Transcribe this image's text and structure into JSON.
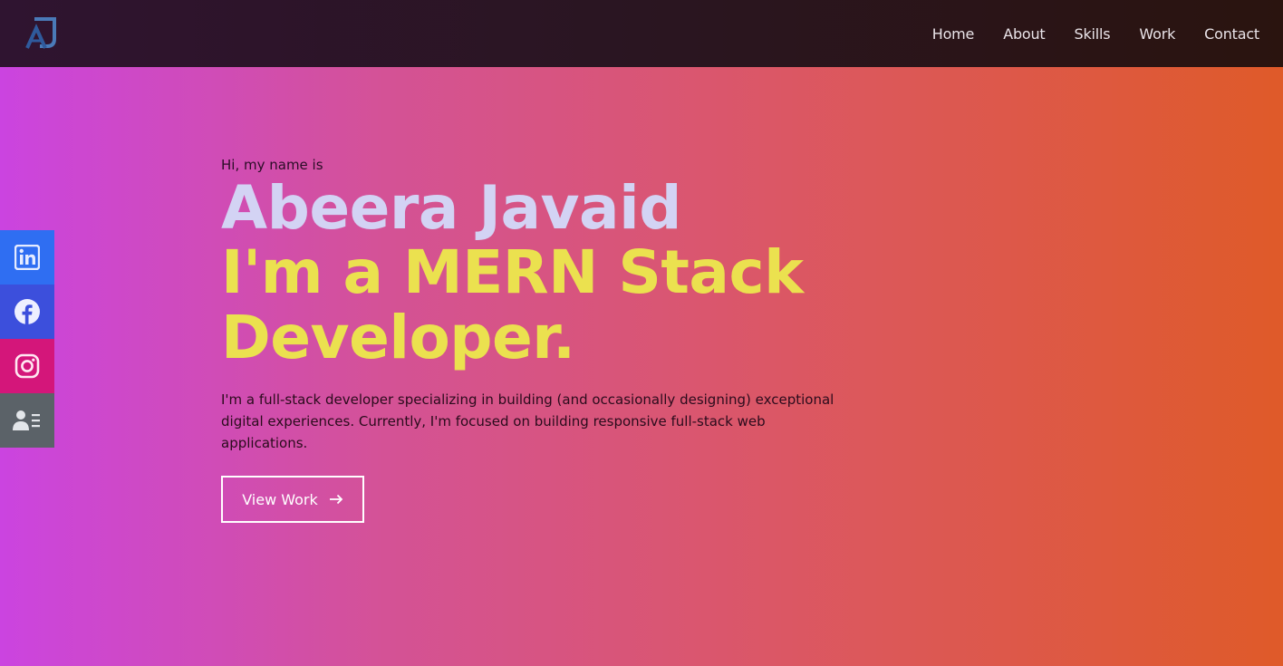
{
  "nav": {
    "logo_icon": "aj-monogram-logo",
    "links": [
      {
        "label": "Home"
      },
      {
        "label": "About"
      },
      {
        "label": "Skills"
      },
      {
        "label": "Work"
      },
      {
        "label": "Contact"
      }
    ]
  },
  "social": [
    {
      "icon": "linkedin-icon",
      "color": "#2f6ef2"
    },
    {
      "icon": "facebook-icon",
      "color": "#3c4fdc"
    },
    {
      "icon": "instagram-icon",
      "color": "#d4167a"
    },
    {
      "icon": "resume-icon",
      "color": "#5b6268"
    }
  ],
  "hero": {
    "greeting": "Hi, my name is",
    "name": "Abeera Javaid",
    "role_line1": "I'm a MERN Stack",
    "role_line2": "Developer.",
    "description": "I'm a full-stack developer specializing in building (and occasionally designing) exceptional digital experiences. Currently, I'm focused on building responsive full-stack web applications.",
    "cta_label": "View Work"
  },
  "colors": {
    "name": "#d3d3f4",
    "role": "#ebe14f",
    "gradient_start": "#cb44e0",
    "gradient_end": "#df5a29"
  }
}
